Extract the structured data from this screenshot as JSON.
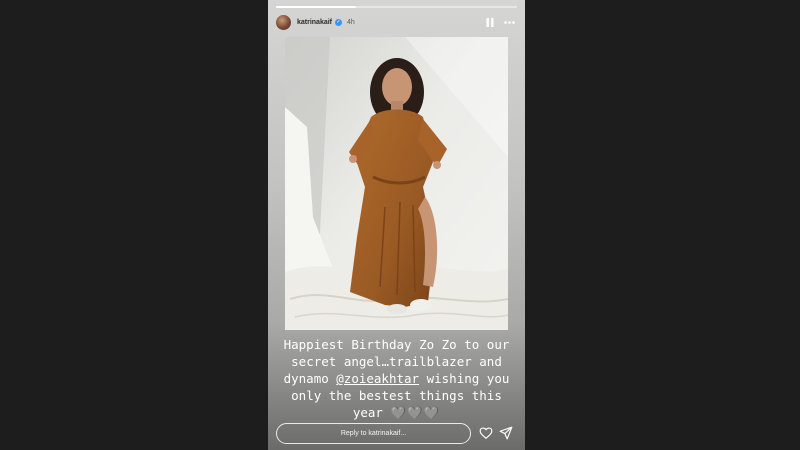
{
  "story": {
    "progress": 0.33,
    "author": {
      "username": "katrinakaif",
      "verified": true,
      "timestamp": "4h"
    },
    "icons": {
      "pause": "pause-icon",
      "more": "more-options-icon",
      "like": "heart-outline-icon",
      "share": "paper-plane-icon"
    },
    "caption": {
      "text_before": "Happiest Birthday Zo Zo to our secret angel…trailblazer and dynamo ",
      "mention": "@zoieakhtar",
      "text_after": " wishing you only the bestest things this year ",
      "emoji": "🩶🩶🩶"
    },
    "reply": {
      "placeholder": "Reply to katrinakaif..."
    }
  },
  "colors": {
    "page_background": "#1d1d1d",
    "verified_badge": "#3897f0",
    "dress": "#9a5a24"
  }
}
